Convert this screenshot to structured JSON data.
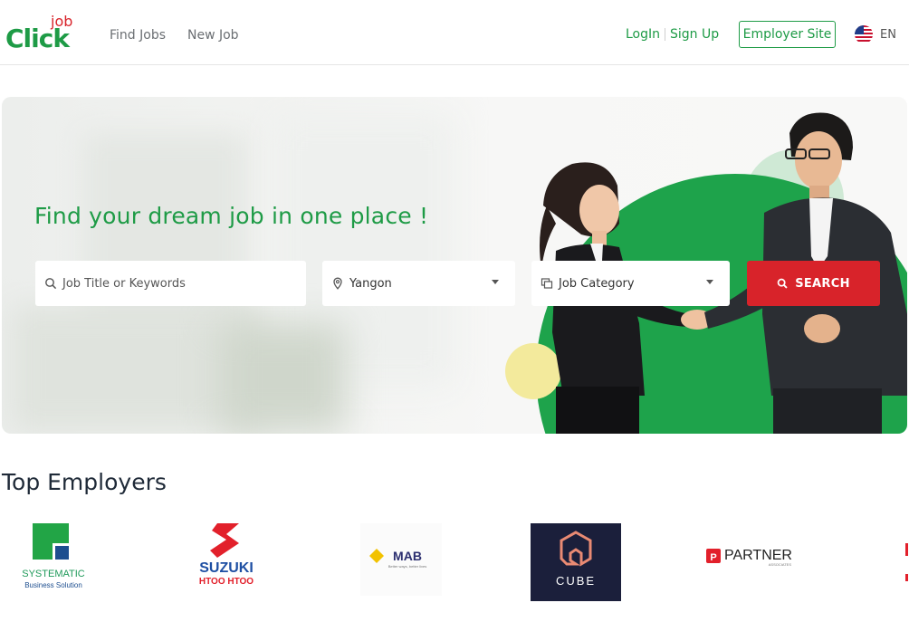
{
  "header": {
    "logo": {
      "small": "job",
      "main": "Click"
    },
    "nav": {
      "find_jobs": "Find Jobs",
      "new_job": "New Job"
    },
    "auth": {
      "login": "LogIn",
      "signup": "Sign Up"
    },
    "employer_site": "Employer Site",
    "language": "EN"
  },
  "hero": {
    "title": "Find your dream job in one place !",
    "search": {
      "keywords_placeholder": "Job Title or Keywords",
      "location_value": "Yangon",
      "category_value": "Job Category",
      "button_label": "SEARCH"
    }
  },
  "employers": {
    "title": "Top Employers",
    "items": [
      {
        "name": "SYSTEMATIC",
        "tagline": "Business Solution"
      },
      {
        "name": "SUZUKI",
        "tagline": "HTOO HTOO"
      },
      {
        "name": "MAB",
        "tagline": "Better ways, better lives"
      },
      {
        "name": "CUBE"
      },
      {
        "name": "PARTNER",
        "tagline": "ASSOCIATES"
      }
    ]
  },
  "colors": {
    "brand_green": "#1e9b46",
    "brand_red": "#d8232a",
    "text_dark": "#1f2a38",
    "cube_bg": "#1b1f3b"
  },
  "icons": {
    "search": "search-icon",
    "location": "location-pin-icon",
    "category": "category-icon",
    "caret": "caret-down-icon",
    "flag": "us-flag-icon"
  }
}
